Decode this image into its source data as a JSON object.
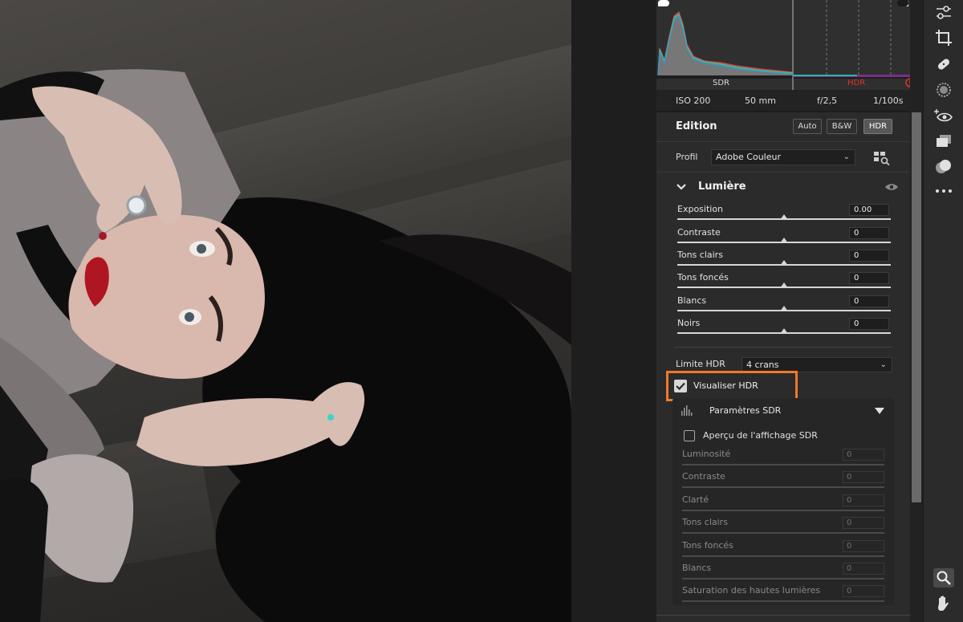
{
  "histogram": {
    "sdr_label": "SDR",
    "hdr_label": "HDR",
    "hdr_color": "#e0312d"
  },
  "exif": {
    "iso": "ISO 200",
    "focal": "50 mm",
    "aperture": "f/2,5",
    "shutter": "1/100s"
  },
  "edition": {
    "title": "Edition",
    "buttons": [
      "Auto",
      "B&W",
      "HDR"
    ],
    "active_button": "HDR"
  },
  "profil": {
    "label": "Profil",
    "value": "Adobe Couleur",
    "browse_icon": "grid-search-icon"
  },
  "lumiere": {
    "title": "Lumière",
    "sliders": [
      {
        "label": "Exposition",
        "value": "0.00"
      },
      {
        "label": "Contraste",
        "value": "0"
      },
      {
        "label": "Tons clairs",
        "value": "0"
      },
      {
        "label": "Tons foncés",
        "value": "0"
      },
      {
        "label": "Blancs",
        "value": "0"
      },
      {
        "label": "Noirs",
        "value": "0"
      }
    ]
  },
  "hdr": {
    "limite_label": "Limite HDR",
    "limite_value": "4 crans",
    "visualiser_label": "Visualiser HDR",
    "visualiser_checked": true,
    "highlight_color": "#f0782a"
  },
  "sdr": {
    "title": "Paramètres SDR",
    "apercu_label": "Aperçu de l'affichage SDR",
    "apercu_checked": false,
    "sliders": [
      {
        "label": "Luminosité",
        "value": "0"
      },
      {
        "label": "Contraste",
        "value": "0"
      },
      {
        "label": "Clarté",
        "value": "0"
      },
      {
        "label": "Tons clairs",
        "value": "0"
      },
      {
        "label": "Tons foncés",
        "value": "0"
      },
      {
        "label": "Blancs",
        "value": "0"
      },
      {
        "label": "Saturation des hautes lumières",
        "value": "0"
      }
    ]
  },
  "toolbar": {
    "tools": [
      "sliders-icon",
      "crop-icon",
      "healing-bandage-icon",
      "mask-icon",
      "red-eye-icon",
      "snapshots-icon",
      "presets-icon",
      "more-icon"
    ],
    "bottom_tools": [
      "zoom-icon",
      "hand-icon"
    ]
  }
}
